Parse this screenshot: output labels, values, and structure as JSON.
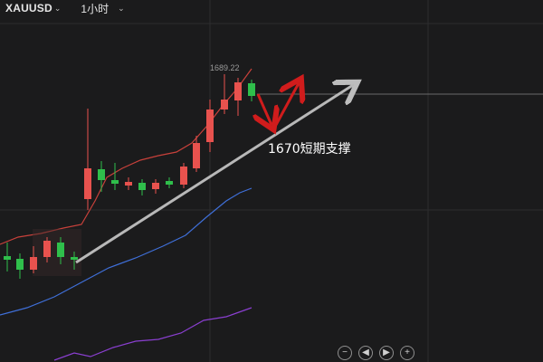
{
  "toolbar": {
    "symbol": "XAUUSD",
    "timeframe": "1小时",
    "dropdown_icon": "chevron-down-icon"
  },
  "chart": {
    "high_label": "1689.22",
    "annotation": "1670短期支撑",
    "colors": {
      "background": "#1b1b1c",
      "bull": "#2fbf4b",
      "bear": "#e8524e",
      "ma_short": "#c8413b",
      "ma_mid": "#3f6fd8",
      "ma_long": "#8a3fd0",
      "trend_arrow": "#b8b8b8",
      "projection_arrow": "#d01c1c"
    }
  },
  "controls": {
    "zoom_out": "−",
    "prev": "◀",
    "next": "▶",
    "zoom_in": "+"
  }
}
